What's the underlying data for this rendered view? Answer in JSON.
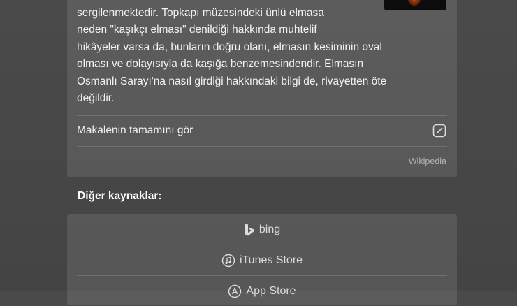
{
  "article": {
    "text": "sergilenmektedir. Topkapı müzesindeki ünlü elmasa\nneden \"kaşıkçı elması\" denildiği hakkında muhtelif\nhikâyeler varsa da, bunların doğru olanı, elmasın kesiminin oval\nolması ve dolayısıyla da kaşığa benzemesindendir. Elmasın\nOsmanlı Sarayı'na nasıl girdiği hakkındaki bilgi de, rivayetten öte\ndeğildir.",
    "thumbnail_icon": "article-thumbnail-image",
    "full_article_label": "Makalenin tamamını gör",
    "full_article_icon": "open-external-icon",
    "source": "Wikipedia"
  },
  "other_sources": {
    "heading": "Diğer kaynaklar:",
    "items": [
      {
        "label": "bing",
        "icon": "bing-icon"
      },
      {
        "label": "iTunes Store",
        "icon": "music-note-icon"
      },
      {
        "label": "App Store",
        "icon": "app-store-icon"
      }
    ]
  }
}
